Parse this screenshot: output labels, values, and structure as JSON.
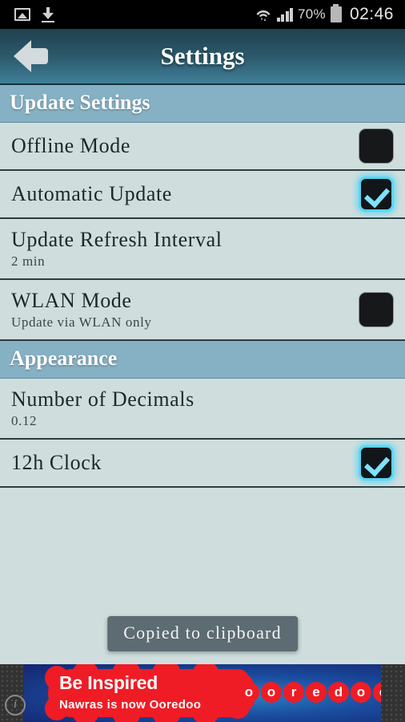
{
  "status_bar": {
    "left_icons": [
      "image-icon",
      "download-icon"
    ],
    "wifi_icon": "wifi-icon",
    "signal_icon": "signal-bars-icon",
    "battery_percent": "70%",
    "battery_icon": "battery-icon",
    "clock": "02:46"
  },
  "action_bar": {
    "back_icon": "back-arrow-icon",
    "title": "Settings"
  },
  "colors": {
    "header_gradient_top": "#1f404e",
    "header_gradient_bottom": "#40809a",
    "section_header_bg": "#86b0c4",
    "row_bg": "#cfdedd",
    "row_divider": "#2f3d3e",
    "checkbox_accent": "#59d6f5",
    "checkbox_bg": "#16181a",
    "toast_bg": "#5d6b72",
    "ad_red": "#ef1c25",
    "ad_blue": "#1a4b9e"
  },
  "sections": [
    {
      "header": "Update Settings",
      "rows": [
        {
          "title": "Offline Mode",
          "summary": "",
          "control": "checkbox",
          "checked": false
        },
        {
          "title": "Automatic Update",
          "summary": "",
          "control": "checkbox",
          "checked": true
        },
        {
          "title": "Update Refresh Interval",
          "summary": "2 min",
          "control": "none",
          "checked": false
        },
        {
          "title": "WLAN Mode",
          "summary": "Update via WLAN only",
          "control": "checkbox",
          "checked": false
        }
      ]
    },
    {
      "header": "Appearance",
      "rows": [
        {
          "title": "Number of Decimals",
          "summary": "0.12",
          "control": "none",
          "checked": false
        },
        {
          "title": "12h Clock",
          "summary": "",
          "control": "checkbox",
          "checked": true
        }
      ]
    }
  ],
  "toast": {
    "message": "Copied to clipboard"
  },
  "ad": {
    "headline": "Be Inspired",
    "subline": "Nawras is now Ooredoo",
    "brand_letters": [
      "o",
      "o",
      "r",
      "e",
      "d",
      "o",
      "o"
    ],
    "info_icon": "info-icon",
    "info_label": "i"
  }
}
